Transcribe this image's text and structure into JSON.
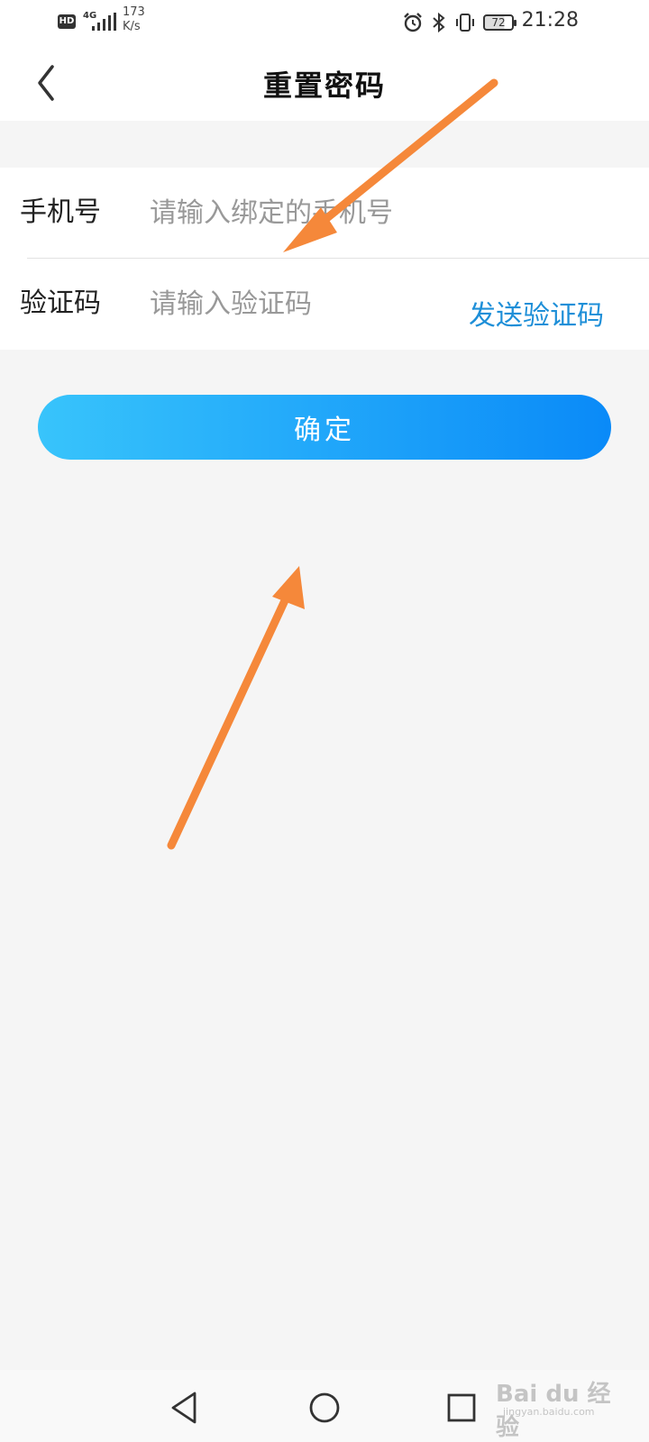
{
  "status_bar": {
    "hd_label": "HD",
    "network_label": "4G",
    "speed_value": "173",
    "speed_unit": "K/s",
    "battery_level": "72",
    "time": "21:28",
    "icons": [
      "alarm-icon",
      "bluetooth-icon",
      "vibrate-icon",
      "battery-icon"
    ]
  },
  "header": {
    "title": "重置密码",
    "back_icon": "chevron-left-icon"
  },
  "form": {
    "phone": {
      "label": "手机号",
      "placeholder": "请输入绑定的手机号",
      "value": ""
    },
    "code": {
      "label": "验证码",
      "placeholder": "请输入验证码",
      "value": "",
      "send_label": "发送验证码"
    }
  },
  "confirm_label": "确定",
  "nav_bar": {
    "icons": [
      "nav-back-icon",
      "nav-home-icon",
      "nav-recent-icon"
    ]
  },
  "watermark": {
    "brand": "Bai du 经验",
    "url": "jingyan.baidu.com"
  },
  "colors": {
    "accent_text": "#1e8fd8",
    "button_gradient_start": "#38c4fb",
    "button_gradient_end": "#0a8af8",
    "annotation_arrow": "#f5883a",
    "background": "#f5f5f5"
  }
}
